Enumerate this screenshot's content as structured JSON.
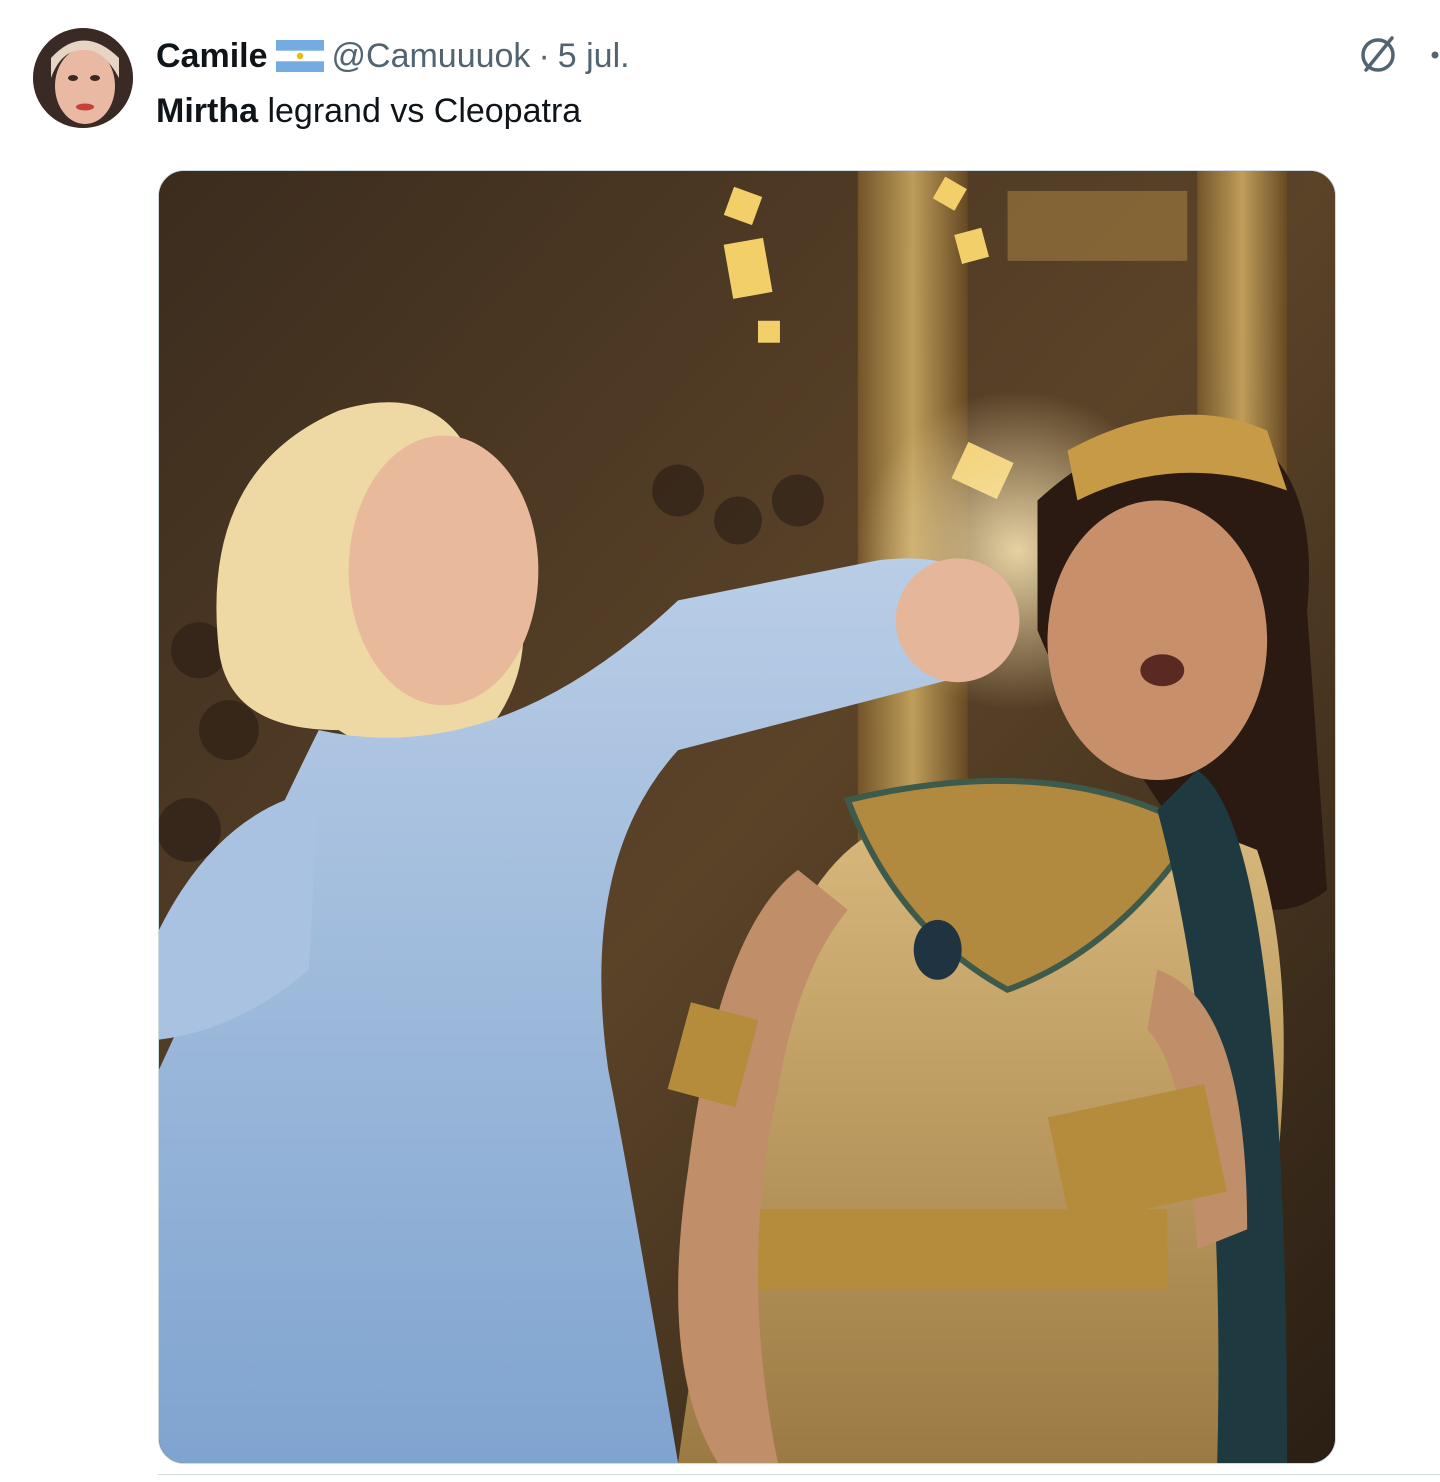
{
  "tweet": {
    "display_name": "Camile",
    "flag_icon": "argentina-flag-icon",
    "handle": "@Camuuuok",
    "separator": "·",
    "date": "5 jul.",
    "text_bold": "Mirtha",
    "text_rest": " legrand vs Cleopatra",
    "grok_icon": "grok-slash-circle-icon",
    "more_icon": "more-dots-icon"
  },
  "media": {
    "type": "photo",
    "scene": "woman-in-blue-gown-punching-woman-in-gold-egyptian-costume"
  },
  "colors": {
    "text_primary": "#0f1419",
    "text_secondary": "#536471",
    "border": "#cfd9de",
    "flag_blue": "#74acdf",
    "flag_sun": "#f6b40e"
  }
}
